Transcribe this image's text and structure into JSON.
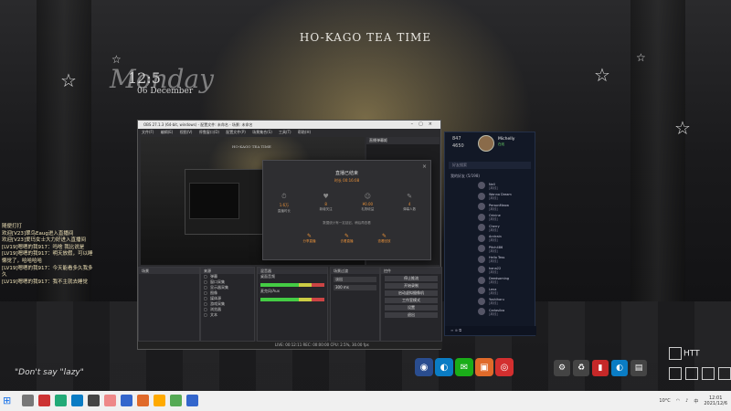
{
  "wallpaper": {
    "title": "HO-KAGO TEA TIME",
    "clock_time": "12:5",
    "clock_date": "06 December",
    "clock_script": "Monday"
  },
  "stream_chat": {
    "lines": [
      {
        "user": "",
        "text": "随便打打"
      },
      {
        "user": "欢迎",
        "text": "欢迎[V23]翠鸟Eaug进入直播间"
      },
      {
        "user": "欢迎",
        "text": "欢迎[V23]爱玛女士大力好进入直播间"
      },
      {
        "user": "[LV19]",
        "text": "[LV19]嗯嗯的我917：吗啥 我比说是"
      },
      {
        "user": "[LV19]",
        "text": "[LV19]嗯嗯的我917：明天放假，可以睡懒觉了，哈哈哈哈"
      },
      {
        "user": "[LV19]",
        "text": "[LV19]嗯嗯的我917：今天能看多久我多久"
      },
      {
        "user": "[LV19]",
        "text": "[LV19]嗯嗯的我917：我不主就去睡觉"
      }
    ],
    "quote": "\"Don't say \"lazy\""
  },
  "obs": {
    "window_title": "OBS 27.1.3 (64-bit, windows) - 配置文件: 未命名 - 场景: 未命名",
    "menu": [
      "文件(F)",
      "编辑(E)",
      "视图(V)",
      "停靠窗口(D)",
      "配置文件(P)",
      "场景集合(S)",
      "工具(T)",
      "帮助(H)"
    ],
    "preview_title": "HO-KAGO TEA TIME",
    "chat_panel_title": "直播弹幕姬",
    "chat_panel_msgs": [
      "嗯嗯的我917：...",
      "木桃大力的",
      "木桃大力的：换个啊?",
      "欢迎 木桃大力的"
    ],
    "docks": {
      "scenes": "场景",
      "sources": "来源",
      "source_items": [
        "弹幕",
        "窗口采集",
        "显示器采集",
        "图像",
        "媒体源",
        "游戏采集",
        "浏览器",
        "文本"
      ],
      "mixer": "混音器",
      "mixer_labels": [
        "桌面音频",
        "麦克风/Aux"
      ],
      "transitions": "场景过渡",
      "transition_value": "淡出",
      "duration": "300 ms",
      "controls": "控件",
      "control_buttons": [
        "停止推流",
        "开始录制",
        "启动虚拟摄像机",
        "工作室模式",
        "设置",
        "退出"
      ]
    },
    "status": "LIVE: 00:12:11   REC: 00:00:00   CPU: 2.5%, 30.00 fps"
  },
  "stats_dialog": {
    "title": "直播已结束",
    "duration": "时长 00:16:08",
    "close": "×",
    "stats": [
      {
        "icon": "⏱",
        "value": "1.6万",
        "label": "直播时长"
      },
      {
        "icon": "♥",
        "value": "8",
        "label": "新增关注"
      },
      {
        "icon": "☺",
        "value": "¥0.00",
        "label": "礼物收益"
      },
      {
        "icon": "✎",
        "value": "4",
        "label": "弹幕人数"
      }
    ],
    "note": "数据统计有一定延迟，稍后再查看",
    "actions": [
      {
        "icon": "✎",
        "label": "分享直播"
      },
      {
        "icon": "✎",
        "label": "去看直播"
      },
      {
        "icon": "✎",
        "label": "查看回放"
      }
    ]
  },
  "qq": {
    "stat1": "847",
    "stat2": "4650",
    "name": "Michelly",
    "status": "在线",
    "search_placeholder": "好友搜索",
    "group": "我的好友 (5/198)",
    "friends": [
      {
        "name": "Nell",
        "status": "[离线]"
      },
      {
        "name": "Wanna Dream",
        "status": "[离线]"
      },
      {
        "name": "PersonMeow",
        "status": "[离线]"
      },
      {
        "name": "Orinine",
        "status": "[离线]"
      },
      {
        "name": "Cherry",
        "status": "[离线]"
      },
      {
        "name": "Arctrain",
        "status": "[离线]"
      },
      {
        "name": "Pitch486",
        "status": "[离线]"
      },
      {
        "name": "Hello Tess",
        "status": "[离线]"
      },
      {
        "name": "hana22",
        "status": "[离线]"
      },
      {
        "name": "Deedsaming",
        "status": "[离线]"
      },
      {
        "name": "Lena",
        "status": "[离线]"
      },
      {
        "name": "Yoshiharu",
        "status": "[离线]"
      },
      {
        "name": "Carlasilva",
        "status": "[离线]"
      }
    ]
  },
  "desktop": {
    "htt_label": "HTT"
  },
  "taskbar": {
    "time": "12:01",
    "date": "2021/12/6",
    "weather": "10°C",
    "lang": "中"
  },
  "colors": {
    "accent_orange": "#e8913a",
    "qq_bg": "#121826"
  }
}
